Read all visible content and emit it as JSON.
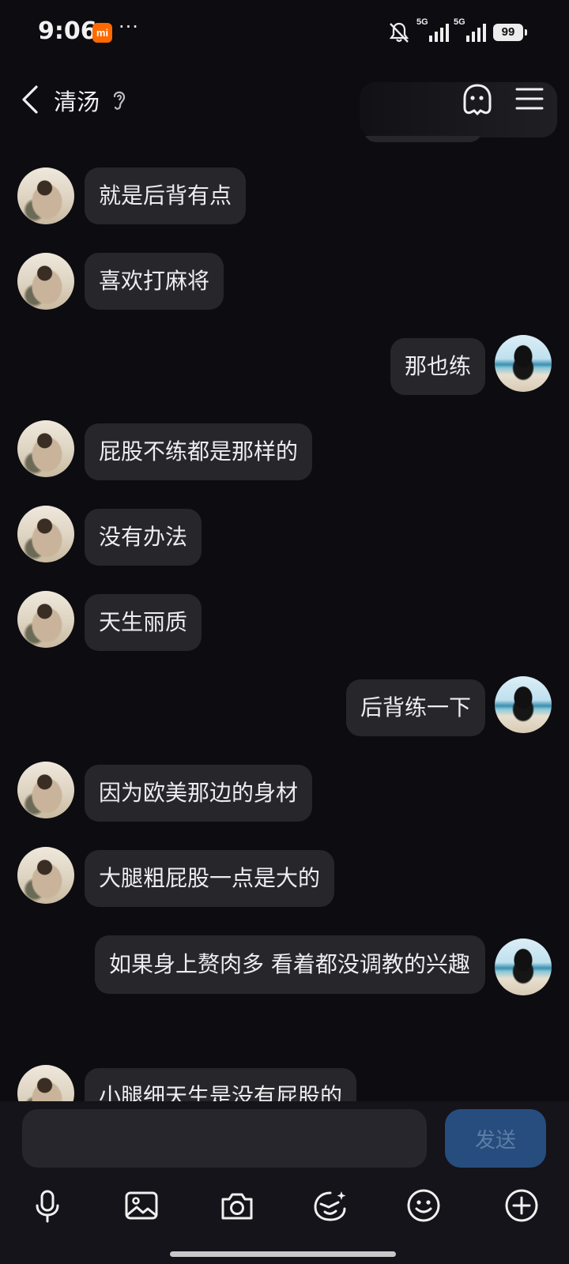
{
  "status_bar": {
    "time": "9:06",
    "carrier_badge": "mi",
    "dots": "···",
    "network_1": "5G",
    "network_2": "5G",
    "battery": "99"
  },
  "header": {
    "title": "清汤",
    "icons": [
      "back-icon",
      "ear-icon",
      "bot-icon",
      "menu-icon"
    ]
  },
  "messages": [
    {
      "side": "left",
      "text": "就是后背有点"
    },
    {
      "side": "left",
      "text": "喜欢打麻将"
    },
    {
      "side": "right",
      "text": "那也练"
    },
    {
      "side": "left",
      "text": "屁股不练都是那样的"
    },
    {
      "side": "left",
      "text": "没有办法"
    },
    {
      "side": "left",
      "text": "天生丽质"
    },
    {
      "side": "right",
      "text": "后背练一下"
    },
    {
      "side": "left",
      "text": "因为欧美那边的身材"
    },
    {
      "side": "left",
      "text": "大腿粗屁股一点是大的"
    },
    {
      "side": "right",
      "text": "如果身上赘肉多 看着都没调教的兴趣"
    },
    {
      "side": "left",
      "text": "小腿细天生是没有屁股的"
    }
  ],
  "input": {
    "value": "",
    "send_label": "发送"
  },
  "toolbar": {
    "icons": [
      "microphone-icon",
      "image-icon",
      "camera-icon",
      "sticker-icon",
      "emoji-icon",
      "plus-icon"
    ]
  },
  "colors": {
    "background": "#0d0c11",
    "bubble": "#26262b",
    "send_button": "#264d7e",
    "mi_badge": "#ff6900"
  }
}
